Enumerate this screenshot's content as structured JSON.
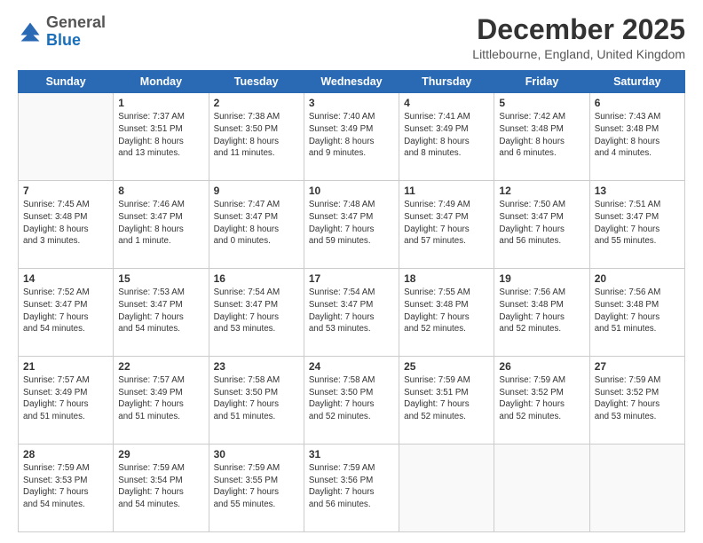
{
  "logo": {
    "general": "General",
    "blue": "Blue"
  },
  "header": {
    "month_year": "December 2025",
    "location": "Littlebourne, England, United Kingdom"
  },
  "days_of_week": [
    "Sunday",
    "Monday",
    "Tuesday",
    "Wednesday",
    "Thursday",
    "Friday",
    "Saturday"
  ],
  "weeks": [
    [
      {
        "day": "",
        "text": ""
      },
      {
        "day": "1",
        "text": "Sunrise: 7:37 AM\nSunset: 3:51 PM\nDaylight: 8 hours\nand 13 minutes."
      },
      {
        "day": "2",
        "text": "Sunrise: 7:38 AM\nSunset: 3:50 PM\nDaylight: 8 hours\nand 11 minutes."
      },
      {
        "day": "3",
        "text": "Sunrise: 7:40 AM\nSunset: 3:49 PM\nDaylight: 8 hours\nand 9 minutes."
      },
      {
        "day": "4",
        "text": "Sunrise: 7:41 AM\nSunset: 3:49 PM\nDaylight: 8 hours\nand 8 minutes."
      },
      {
        "day": "5",
        "text": "Sunrise: 7:42 AM\nSunset: 3:48 PM\nDaylight: 8 hours\nand 6 minutes."
      },
      {
        "day": "6",
        "text": "Sunrise: 7:43 AM\nSunset: 3:48 PM\nDaylight: 8 hours\nand 4 minutes."
      }
    ],
    [
      {
        "day": "7",
        "text": "Sunrise: 7:45 AM\nSunset: 3:48 PM\nDaylight: 8 hours\nand 3 minutes."
      },
      {
        "day": "8",
        "text": "Sunrise: 7:46 AM\nSunset: 3:47 PM\nDaylight: 8 hours\nand 1 minute."
      },
      {
        "day": "9",
        "text": "Sunrise: 7:47 AM\nSunset: 3:47 PM\nDaylight: 8 hours\nand 0 minutes."
      },
      {
        "day": "10",
        "text": "Sunrise: 7:48 AM\nSunset: 3:47 PM\nDaylight: 7 hours\nand 59 minutes."
      },
      {
        "day": "11",
        "text": "Sunrise: 7:49 AM\nSunset: 3:47 PM\nDaylight: 7 hours\nand 57 minutes."
      },
      {
        "day": "12",
        "text": "Sunrise: 7:50 AM\nSunset: 3:47 PM\nDaylight: 7 hours\nand 56 minutes."
      },
      {
        "day": "13",
        "text": "Sunrise: 7:51 AM\nSunset: 3:47 PM\nDaylight: 7 hours\nand 55 minutes."
      }
    ],
    [
      {
        "day": "14",
        "text": "Sunrise: 7:52 AM\nSunset: 3:47 PM\nDaylight: 7 hours\nand 54 minutes."
      },
      {
        "day": "15",
        "text": "Sunrise: 7:53 AM\nSunset: 3:47 PM\nDaylight: 7 hours\nand 54 minutes."
      },
      {
        "day": "16",
        "text": "Sunrise: 7:54 AM\nSunset: 3:47 PM\nDaylight: 7 hours\nand 53 minutes."
      },
      {
        "day": "17",
        "text": "Sunrise: 7:54 AM\nSunset: 3:47 PM\nDaylight: 7 hours\nand 53 minutes."
      },
      {
        "day": "18",
        "text": "Sunrise: 7:55 AM\nSunset: 3:48 PM\nDaylight: 7 hours\nand 52 minutes."
      },
      {
        "day": "19",
        "text": "Sunrise: 7:56 AM\nSunset: 3:48 PM\nDaylight: 7 hours\nand 52 minutes."
      },
      {
        "day": "20",
        "text": "Sunrise: 7:56 AM\nSunset: 3:48 PM\nDaylight: 7 hours\nand 51 minutes."
      }
    ],
    [
      {
        "day": "21",
        "text": "Sunrise: 7:57 AM\nSunset: 3:49 PM\nDaylight: 7 hours\nand 51 minutes."
      },
      {
        "day": "22",
        "text": "Sunrise: 7:57 AM\nSunset: 3:49 PM\nDaylight: 7 hours\nand 51 minutes."
      },
      {
        "day": "23",
        "text": "Sunrise: 7:58 AM\nSunset: 3:50 PM\nDaylight: 7 hours\nand 51 minutes."
      },
      {
        "day": "24",
        "text": "Sunrise: 7:58 AM\nSunset: 3:50 PM\nDaylight: 7 hours\nand 52 minutes."
      },
      {
        "day": "25",
        "text": "Sunrise: 7:59 AM\nSunset: 3:51 PM\nDaylight: 7 hours\nand 52 minutes."
      },
      {
        "day": "26",
        "text": "Sunrise: 7:59 AM\nSunset: 3:52 PM\nDaylight: 7 hours\nand 52 minutes."
      },
      {
        "day": "27",
        "text": "Sunrise: 7:59 AM\nSunset: 3:52 PM\nDaylight: 7 hours\nand 53 minutes."
      }
    ],
    [
      {
        "day": "28",
        "text": "Sunrise: 7:59 AM\nSunset: 3:53 PM\nDaylight: 7 hours\nand 54 minutes."
      },
      {
        "day": "29",
        "text": "Sunrise: 7:59 AM\nSunset: 3:54 PM\nDaylight: 7 hours\nand 54 minutes."
      },
      {
        "day": "30",
        "text": "Sunrise: 7:59 AM\nSunset: 3:55 PM\nDaylight: 7 hours\nand 55 minutes."
      },
      {
        "day": "31",
        "text": "Sunrise: 7:59 AM\nSunset: 3:56 PM\nDaylight: 7 hours\nand 56 minutes."
      },
      {
        "day": "",
        "text": ""
      },
      {
        "day": "",
        "text": ""
      },
      {
        "day": "",
        "text": ""
      }
    ]
  ]
}
